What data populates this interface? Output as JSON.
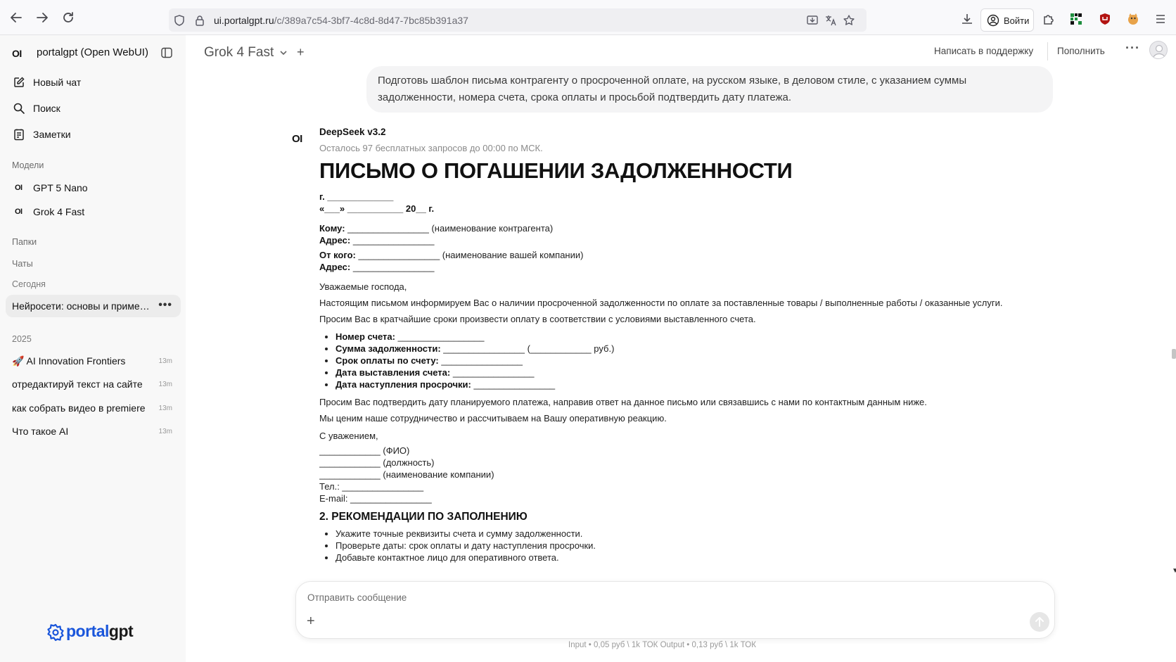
{
  "browser": {
    "url_host": "ui.portalgpt.ru",
    "url_path": "/c/389a7c54-3bf7-4c8d-8d47-7bc85b391a37",
    "login_label": "Войти"
  },
  "sidebar": {
    "logo_mark": "OI",
    "app_title": "portalgpt (Open WebUI)",
    "nav": [
      {
        "label": "Новый чат",
        "icon": "new-chat-icon"
      },
      {
        "label": "Поиск",
        "icon": "search-icon"
      },
      {
        "label": "Заметки",
        "icon": "notes-icon"
      }
    ],
    "models_heading": "Модели",
    "models": [
      {
        "mark": "OI",
        "label": "GPT 5 Nano"
      },
      {
        "mark": "OI",
        "label": "Grok 4 Fast"
      }
    ],
    "folders_heading": "Папки",
    "chats_heading": "Чаты",
    "today_heading": "Сегодня",
    "today_chats": [
      {
        "label": "Нейросети: основы и применение",
        "more": "•••"
      }
    ],
    "year_heading": "2025",
    "older_chats": [
      {
        "label": "🚀 AI Innovation Frontiers",
        "time": "13m"
      },
      {
        "label": "отредактируй текст на сайте",
        "time": "13m"
      },
      {
        "label": "как собрать видео в premiere",
        "time": "13m"
      },
      {
        "label": "Что такое AI",
        "time": "13m"
      }
    ],
    "brand_a": "portal",
    "brand_b": "gpt",
    "brand_color": "#1a56db"
  },
  "header": {
    "model_name": "Grok 4 Fast",
    "add_model": "+",
    "support_link": "Написать в поддержку",
    "topup_link": "Пополнить",
    "more": "···"
  },
  "user_message": "Подготовь шаблон письма контрагенту о просроченной оплате, на русском языке, в деловом стиле, с указанием суммы задолженности, номера счета, срока оплаты и просьбой подтвердить дату платежа.",
  "assistant": {
    "mark": "OI",
    "name": "DeepSeek v3.2",
    "quota_note": "Осталось 97 бесплатных запросов до 00:00 по МСК.",
    "doc": {
      "title": "ПИСЬМО О ПОГАШЕНИИ ЗАДОЛЖЕННОСТИ",
      "city": "г. _____________",
      "date": "«___» ___________ 20__ г.",
      "to_label": "Кому:",
      "to_value": " ________________ (наименование контрагента)",
      "addr1_label": "Адрес:",
      "addr1_value": " ________________",
      "from_label": "От кого:",
      "from_value": " ________________ (наименование вашей компании)",
      "addr2_label": "Адрес:",
      "addr2_value": " ________________",
      "greeting": "Уважаемые господа,",
      "para1": "Настоящим письмом информируем Вас о наличии просроченной задолженности по оплате за поставленные товары / выполненные работы / оказанные услуги.",
      "para2": "Просим Вас в кратчайшие сроки произвести оплату в соответствии с условиями выставленного счета.",
      "fields": [
        {
          "label": "Номер счета:",
          "value": " _________________"
        },
        {
          "label": "Сумма задолженности:",
          "value": " ________________ (____________ руб.)"
        },
        {
          "label": "Срок оплаты по счету:",
          "value": " ________________"
        },
        {
          "label": "Дата выставления счета:",
          "value": " ________________"
        },
        {
          "label": "Дата наступления просрочки:",
          "value": " ________________"
        }
      ],
      "para3": "Просим Вас подтвердить дату планируемого платежа, направив ответ на данное письмо или связавшись с нами по контактным данным ниже.",
      "para4": "Мы ценим наше сотрудничество и рассчитываем на Вашу оперативную реакцию.",
      "regards": "С уважением,",
      "sig_name": "____________ (ФИО)",
      "sig_position": "____________ (должность)",
      "sig_company": "____________ (наименование компании)",
      "phone": "Тел.: ________________",
      "email": "E-mail: ________________",
      "section2_title": "2. РЕКОМЕНДАЦИИ ПО ЗАПОЛНЕНИЮ",
      "tips": [
        "Укажите точные реквизиты счета и сумму задолженности.",
        "Проверьте даты: срок оплаты и дату наступления просрочки.",
        "Добавьте контактное лицо для оперативного ответа."
      ]
    }
  },
  "composer": {
    "placeholder": "Отправить сообщение",
    "plus": "+"
  },
  "pricing": "Input • 0,05 руб \\ 1k ТОК Output • 0,13 руб \\ 1k ТОК"
}
